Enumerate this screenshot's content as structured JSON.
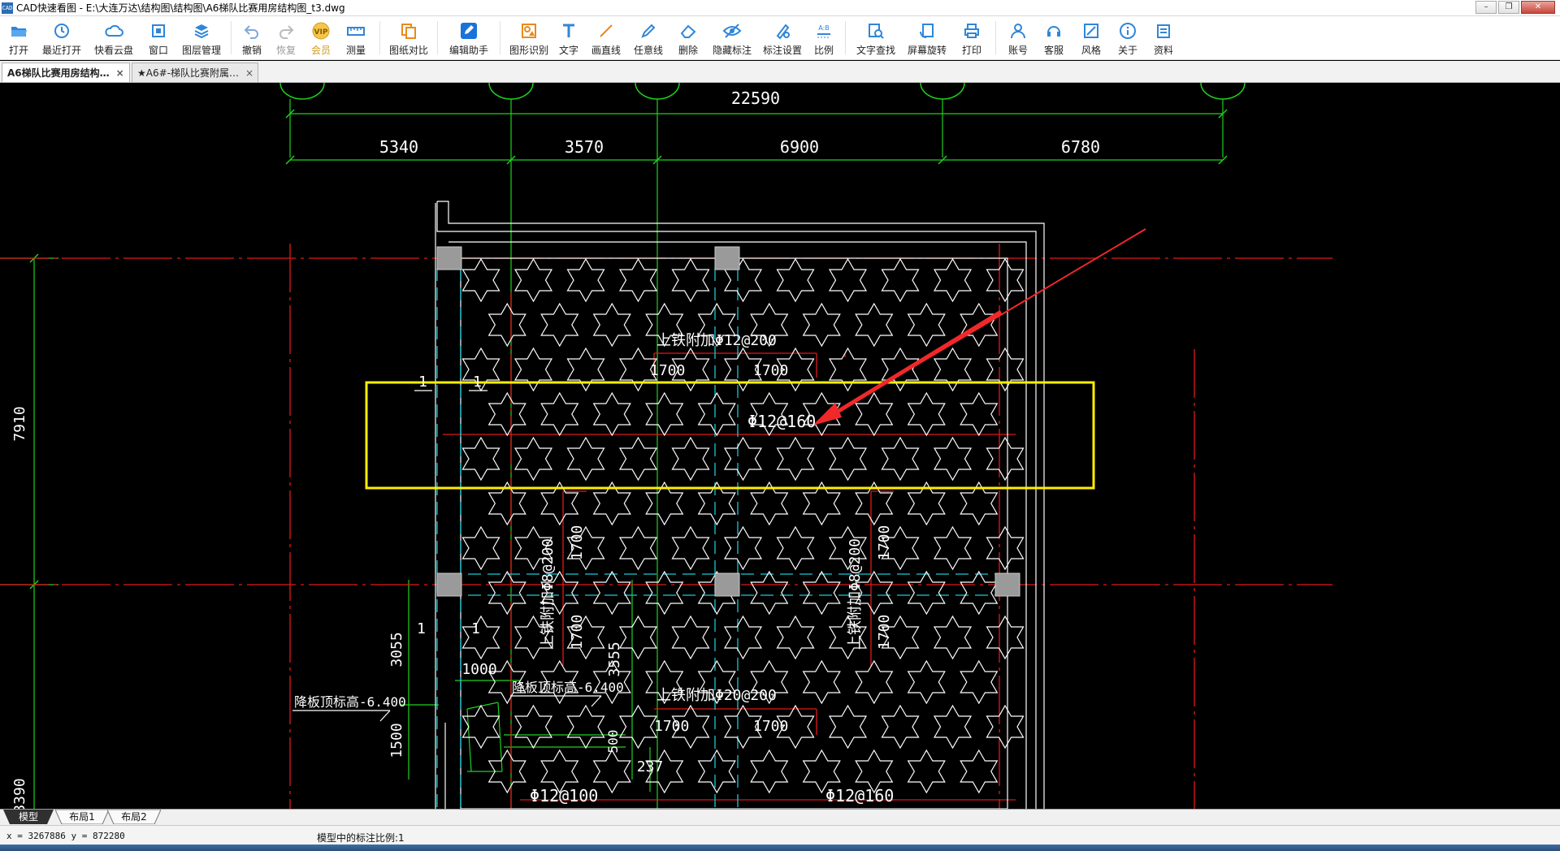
{
  "window": {
    "logo_text": "CAD",
    "title": "CAD快速看图 - E:\\大连万达\\结构图\\结构图\\A6梯队比赛用房结构图_t3.dwg",
    "controls": [
      "–",
      "❐",
      "✕"
    ]
  },
  "toolbar": {
    "items": [
      {
        "label": "打开",
        "icon": "open-folder-icon"
      },
      {
        "label": "最近打开",
        "icon": "recent-clock-icon"
      },
      {
        "label": "快看云盘",
        "icon": "cloud-icon"
      },
      {
        "label": "窗口",
        "icon": "window-icon"
      },
      {
        "label": "图层管理",
        "icon": "layers-icon"
      },
      {
        "label": "撤销",
        "icon": "undo-icon"
      },
      {
        "label": "恢复",
        "icon": "redo-icon"
      },
      {
        "label": "会员",
        "icon": "vip-icon"
      },
      {
        "label": "测量",
        "icon": "ruler-icon"
      },
      {
        "label": "图纸对比",
        "icon": "compare-icon"
      },
      {
        "label": "编辑助手",
        "icon": "edit-assistant-icon"
      },
      {
        "label": "图形识别",
        "icon": "shape-recognize-icon"
      },
      {
        "label": "文字",
        "icon": "text-icon"
      },
      {
        "label": "画直线",
        "icon": "line-icon"
      },
      {
        "label": "任意线",
        "icon": "pen-icon"
      },
      {
        "label": "删除",
        "icon": "eraser-icon"
      },
      {
        "label": "隐藏标注",
        "icon": "eye-hide-icon"
      },
      {
        "label": "标注设置",
        "icon": "annotation-settings-icon"
      },
      {
        "label": "比例",
        "icon": "scale-icon"
      },
      {
        "label": "文字查找",
        "icon": "text-search-icon"
      },
      {
        "label": "屏幕旋转",
        "icon": "rotate-icon"
      },
      {
        "label": "打印",
        "icon": "printer-icon"
      },
      {
        "label": "账号",
        "icon": "user-icon"
      },
      {
        "label": "客服",
        "icon": "headset-icon"
      },
      {
        "label": "风格",
        "icon": "style-icon"
      },
      {
        "label": "关于",
        "icon": "info-icon"
      },
      {
        "label": "资料",
        "icon": "docs-icon"
      }
    ]
  },
  "tabs": [
    {
      "label": "A6梯队比赛用房结构…",
      "close": "×",
      "active": true
    },
    {
      "label": "★A6#-梯队比赛附属…",
      "close": "×",
      "active": false
    }
  ],
  "drawing": {
    "dim_total": "22590",
    "dim_bays": [
      "5340",
      "3570",
      "6900",
      "6780"
    ],
    "dim_left_7910": "7910",
    "dim_left_3390": "3390",
    "dim_3055": "3055",
    "dim_1500": "1500",
    "dim_1000": "1000",
    "dim_3555": "3555",
    "dim_500": "500",
    "dim_237": "237",
    "section_mark": "1",
    "rebar_top_12": "上铁附加Φ12@200",
    "rebar_top_20": "上铁附加Φ20@200",
    "rebar_top_left_8": "上铁附加Φ8@200",
    "rebar_top_right_8": "上铁附加Φ8@200",
    "rebar_160_mid": "Φ12@160",
    "rebar_100": "Φ12@100",
    "rebar_160_bot": "Φ12@160",
    "len_1700": "1700",
    "level_note_a": "降板顶标高-6.400",
    "level_note_b": "降板顶标高-6.400"
  },
  "layout_tabs": [
    "模型",
    "布局1",
    "布局2"
  ],
  "status": {
    "coords": "x = 3267886  y = 872280",
    "scale": "模型中的标注比例:1"
  },
  "colors": {
    "grid_green": "#1fd11f",
    "axis_red": "#e01818",
    "wall_white": "#ffffff",
    "cyan_dash": "#19c8d6",
    "highlight_yellow": "#ffee00",
    "arrow_red": "#f0282a",
    "column_gray": "#9a9a9a"
  }
}
